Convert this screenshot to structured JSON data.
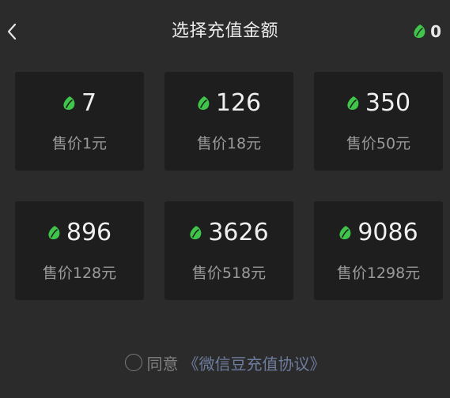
{
  "header": {
    "title": "选择充值金额",
    "balance": "0",
    "back_icon": "chevron-left-icon",
    "bean_icon": "green-leaf-bean-icon"
  },
  "colors": {
    "background": "#2b2b2b",
    "card": "#1e1e1e",
    "bean_green": "#3ec54a",
    "link": "#6e7c9e"
  },
  "packages": [
    {
      "amount": "7",
      "price": "售价1元"
    },
    {
      "amount": "126",
      "price": "售价18元"
    },
    {
      "amount": "350",
      "price": "售价50元"
    },
    {
      "amount": "896",
      "price": "售价128元"
    },
    {
      "amount": "3626",
      "price": "售价518元"
    },
    {
      "amount": "9086",
      "price": "售价1298元"
    }
  ],
  "agreement": {
    "prefix": "同意",
    "link": "《微信豆充值协议》"
  }
}
